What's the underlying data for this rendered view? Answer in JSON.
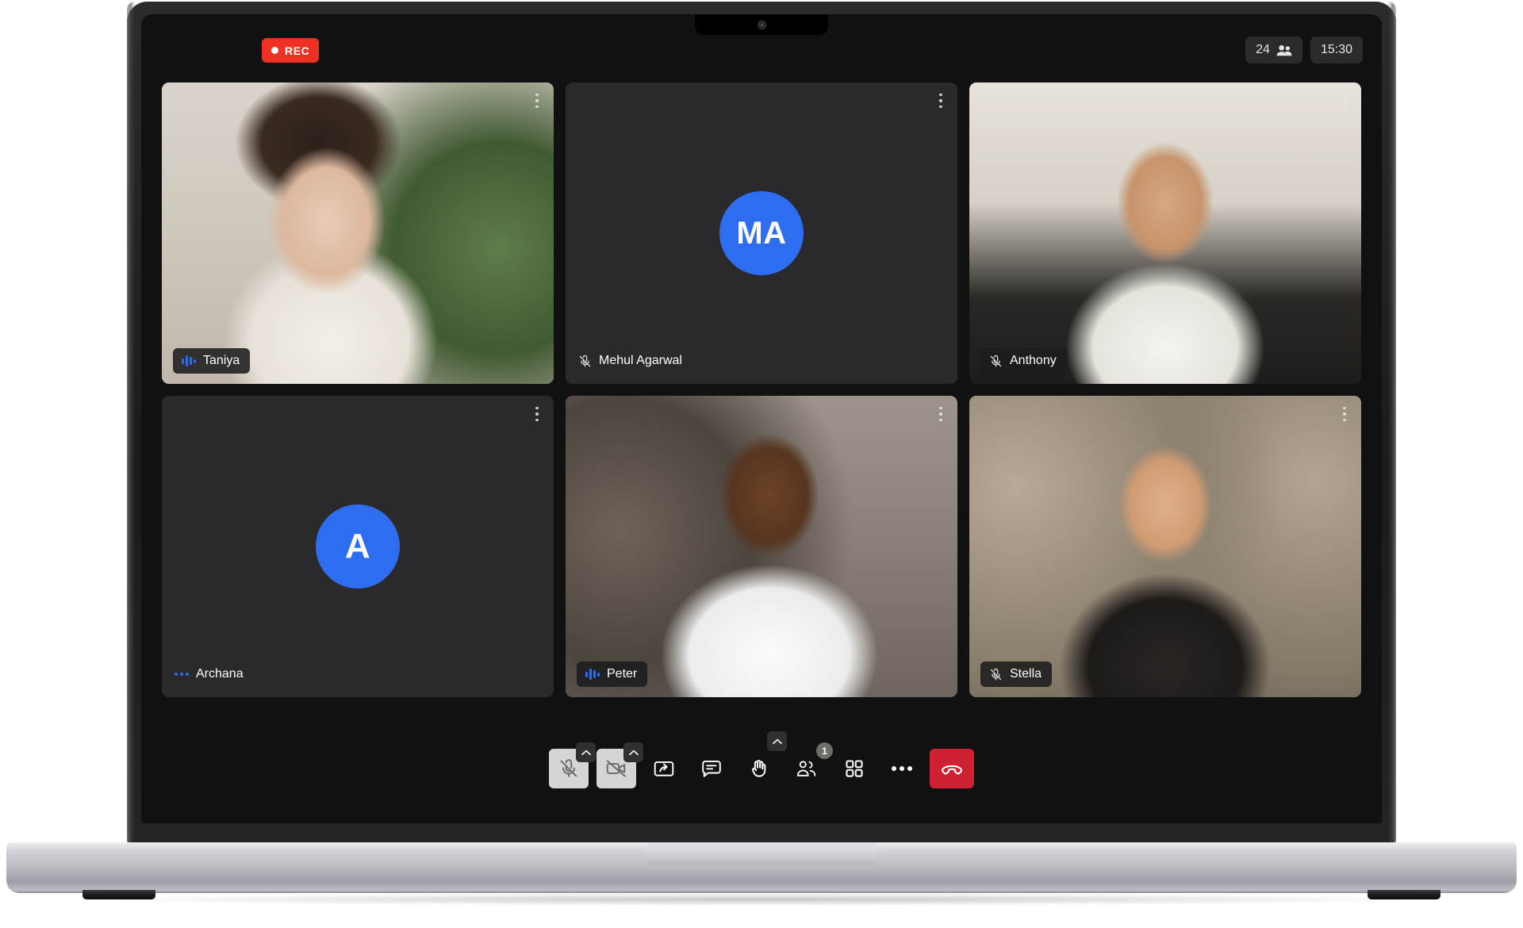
{
  "app": {
    "recording_label": "REC",
    "participant_count": "24",
    "clock": "15:30"
  },
  "tiles": [
    {
      "name": "Taniya",
      "kind": "video",
      "photo_class": "ph-taniya",
      "status": "speaking",
      "pill_style": "pill",
      "initials": ""
    },
    {
      "name": "Mehul Agarwal",
      "kind": "avatar",
      "photo_class": "",
      "status": "muted",
      "pill_style": "plain",
      "initials": "MA"
    },
    {
      "name": "Anthony",
      "kind": "video",
      "photo_class": "ph-anthony",
      "status": "muted",
      "pill_style": "pill",
      "initials": ""
    },
    {
      "name": "Archana",
      "kind": "avatar",
      "photo_class": "",
      "status": "dots",
      "pill_style": "plain",
      "initials": "A"
    },
    {
      "name": "Peter",
      "kind": "video",
      "photo_class": "ph-peter",
      "status": "speaking",
      "pill_style": "pill",
      "initials": ""
    },
    {
      "name": "Stella",
      "kind": "video",
      "photo_class": "ph-stella",
      "status": "muted",
      "pill_style": "pill",
      "initials": ""
    }
  ],
  "toolbar": {
    "mic_label": "Mute",
    "mic_state": "muted",
    "camera_label": "Camera",
    "camera_state": "off",
    "share_label": "Share screen",
    "chat_label": "Chat",
    "raise_hand_label": "Raise hand",
    "participants_label": "Participants",
    "participants_badge": "1",
    "layout_label": "Grid view",
    "more_label": "More options",
    "end_call_label": "End call"
  },
  "colors": {
    "accent_blue": "#2f6df0",
    "rec_red": "#ef3124",
    "end_call_red": "#cf2031",
    "tile_bg": "#2a2a2c",
    "app_bg": "#111111"
  }
}
